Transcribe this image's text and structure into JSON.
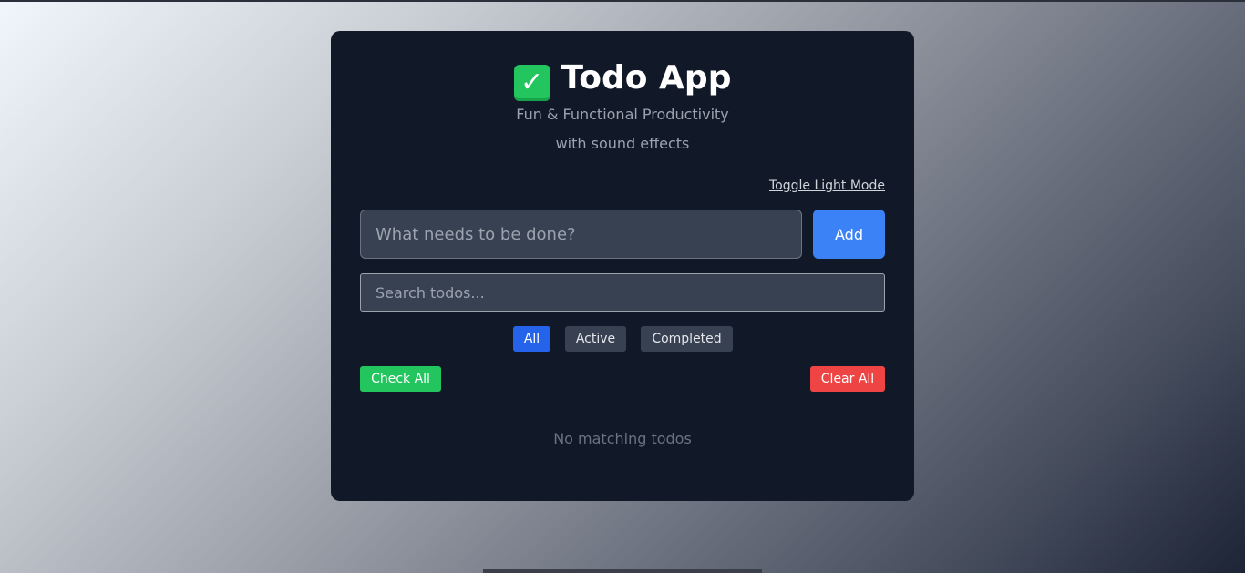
{
  "app": {
    "title_icon": "check-mark-button-emoji",
    "title_icon_glyph": "✓",
    "title": "Todo App",
    "subtitle_line1": "Fun & Functional Productivity",
    "subtitle_line2": "with sound effects"
  },
  "toggle_label": "Toggle Light Mode",
  "new_todo": {
    "placeholder": "What needs to be done?",
    "value": "",
    "add_label": "Add"
  },
  "search": {
    "placeholder": "Search todos...",
    "value": ""
  },
  "filters": [
    {
      "label": "All",
      "active": true
    },
    {
      "label": "Active",
      "active": false
    },
    {
      "label": "Completed",
      "active": false
    }
  ],
  "actions": {
    "check_all_label": "Check All",
    "clear_all_label": "Clear All"
  },
  "empty_message": "No matching todos",
  "colors": {
    "card_bg": "#111827",
    "accent_blue": "#3b82f6",
    "filter_selected": "#2563eb",
    "success_green": "#22c55e",
    "danger_red": "#ef4444"
  }
}
